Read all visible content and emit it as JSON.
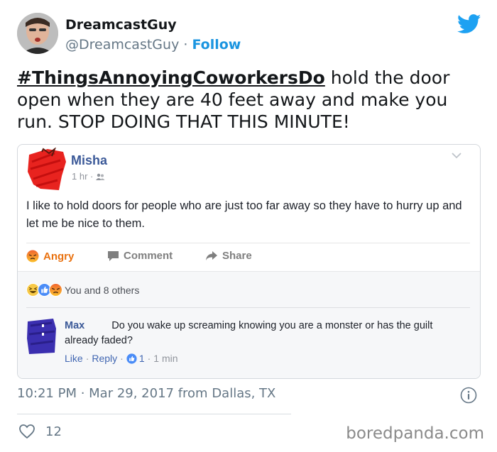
{
  "header": {
    "name": "DreamcastGuy",
    "handle": "@DreamcastGuy",
    "separator": " · ",
    "follow_label": "Follow",
    "brand_icon": "twitter-bird-icon",
    "brand_color": "#1da1f2"
  },
  "tweet": {
    "hashtag": "#ThingsAnnoyingCoworkersDo",
    "text": " hold the door open when they are 40 feet away and make you run. STOP DOING THAT THIS MINUTE!"
  },
  "embedded_post": {
    "author": "Misha",
    "time": "1 hr",
    "meta_sep": " · ",
    "privacy_icon": "friends-icon",
    "text": "I like to hold doors for people who are just too far away so they have to hurry up and let me be nice to them.",
    "actions": {
      "angry": "Angry",
      "comment": "Comment",
      "share": "Share"
    },
    "reactions_text": "You and 8 others",
    "comment": {
      "author": "Max",
      "text": "Do you wake up screaming knowing you are a monster or has the guilt already faded?",
      "like": "Like",
      "reply": "Reply",
      "likes_count": "1",
      "time": "1 min",
      "dot": "·"
    }
  },
  "footer": {
    "timestamp": "10:21 PM · Mar 29, 2017 from Dallas, TX",
    "like_count": "12",
    "watermark": "boredpanda.com"
  }
}
